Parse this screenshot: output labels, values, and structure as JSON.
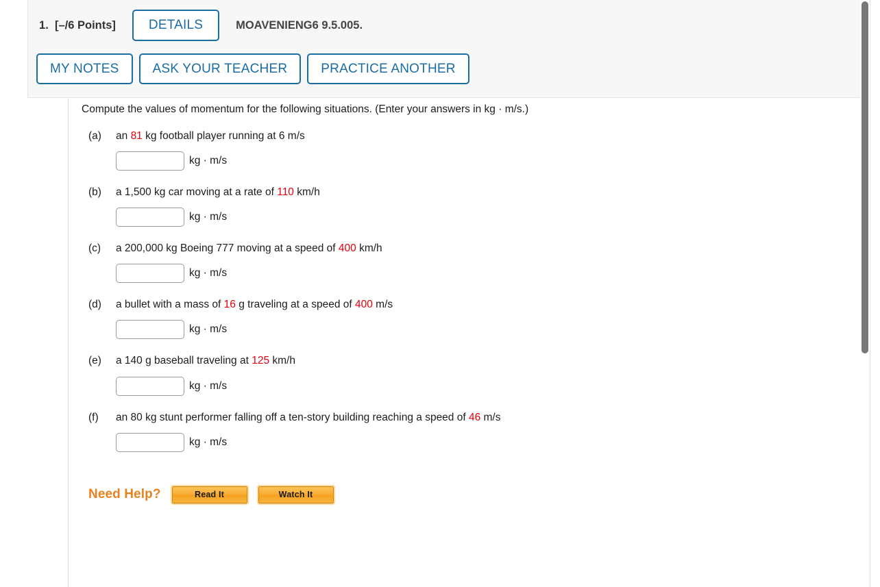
{
  "header": {
    "question_number": "1.",
    "points": "[–/6 Points]",
    "details_label": "DETAILS",
    "problem_code": "MOAVENIENG6 9.5.005.",
    "my_notes_label": "MY NOTES",
    "ask_teacher_label": "ASK YOUR TEACHER",
    "practice_another_label": "PRACTICE ANOTHER"
  },
  "colors": {
    "link_blue": "#1b6ca3",
    "highlight_red": "#e7000b",
    "help_orange": "#e8821e",
    "panel_gray": "#f7f7f7"
  },
  "question": {
    "prompt": "Compute the values of momentum for the following situations. (Enter your answers in kg · m/s.)",
    "unit": "kg · m/s",
    "input_value": "",
    "parts": [
      {
        "label": "(a)",
        "pre": "an ",
        "value1": "81",
        "mid": " kg football player running at 6 m/s",
        "value2": "",
        "post": ""
      },
      {
        "label": "(b)",
        "pre": "a 1,500 kg car moving at a rate of ",
        "value1": "110",
        "mid": " km/h",
        "value2": "",
        "post": ""
      },
      {
        "label": "(c)",
        "pre": "a 200,000 kg Boeing 777 moving at a speed of ",
        "value1": "400",
        "mid": " km/h",
        "value2": "",
        "post": ""
      },
      {
        "label": "(d)",
        "pre": "a bullet with a mass of ",
        "value1": "16",
        "mid": " g traveling at a speed of ",
        "value2": "400",
        "post": " m/s"
      },
      {
        "label": "(e)",
        "pre": "a 140 g baseball traveling at ",
        "value1": "125",
        "mid": " km/h",
        "value2": "",
        "post": ""
      },
      {
        "label": "(f)",
        "pre": "an 80 kg stunt performer falling off a ten-story building reaching a speed of ",
        "value1": "46",
        "mid": " m/s",
        "value2": "",
        "post": ""
      }
    ]
  },
  "need_help": {
    "label": "Need Help?",
    "read_it_label": "Read It",
    "watch_it_label": "Watch It"
  }
}
